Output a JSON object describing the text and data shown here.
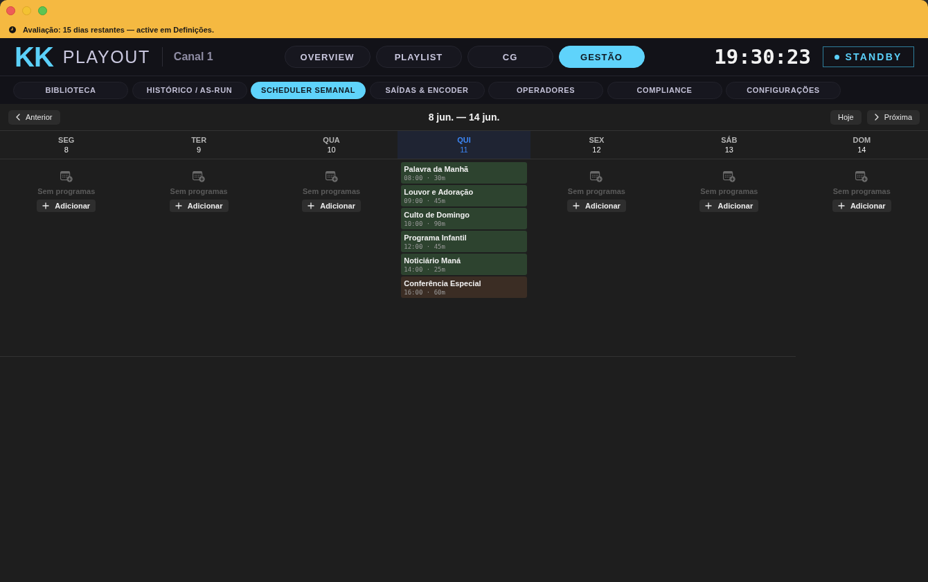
{
  "trial_banner": {
    "text": "Avaliação: 15 dias restantes — active em Definições."
  },
  "header": {
    "logo_mark": "KK",
    "logo_text": "PLAYOUT",
    "channel": "Canal 1",
    "nav_tabs": [
      {
        "label": "OVERVIEW",
        "selected": false
      },
      {
        "label": "PLAYLIST",
        "selected": false
      },
      {
        "label": "CG",
        "selected": false
      },
      {
        "label": "GESTÃO",
        "selected": true
      }
    ],
    "clock": "19:30:23",
    "status": {
      "label": "STANDBY"
    }
  },
  "sub_tabs": [
    {
      "label": "BIBLIOTECA",
      "selected": false
    },
    {
      "label": "HISTÓRICO / AS-RUN",
      "selected": false
    },
    {
      "label": "SCHEDULER SEMANAL",
      "selected": true
    },
    {
      "label": "SAÍDAS & ENCODER",
      "selected": false
    },
    {
      "label": "OPERADORES",
      "selected": false
    },
    {
      "label": "COMPLIANCE",
      "selected": false
    },
    {
      "label": "CONFIGURAÇÕES",
      "selected": false
    }
  ],
  "toolbar": {
    "prev_button": "Anterior",
    "range": "8 jun. — 14 jun.",
    "today_button": "Hoje",
    "next_button": "Próxima"
  },
  "week": {
    "days": [
      {
        "name": "SEG",
        "date": "8",
        "today": false,
        "empty_text": "Sem programas",
        "add_label": "Adicionar"
      },
      {
        "name": "TER",
        "date": "9",
        "today": false,
        "empty_text": "Sem programas",
        "add_label": "Adicionar"
      },
      {
        "name": "QUA",
        "date": "10",
        "today": false,
        "empty_text": "Sem programas",
        "add_label": "Adicionar"
      },
      {
        "name": "QUI",
        "date": "11",
        "today": true,
        "programs": [
          {
            "title": "Palavra da Manhã",
            "time": "08:00 · 30m",
            "color": "#2d432f"
          },
          {
            "title": "Louvor e Adoração",
            "time": "09:00 · 45m",
            "color": "#2d432f"
          },
          {
            "title": "Culto de Domingo",
            "time": "10:00 · 90m",
            "color": "#2d432f"
          },
          {
            "title": "Programa Infantil",
            "time": "12:00 · 45m",
            "color": "#2d432f"
          },
          {
            "title": "Noticiário Maná",
            "time": "14:00 · 25m",
            "color": "#2d432f"
          },
          {
            "title": "Conferência Especial",
            "time": "16:00 · 60m",
            "color": "#3b2d24"
          }
        ]
      },
      {
        "name": "SEX",
        "date": "12",
        "today": false,
        "empty_text": "Sem programas",
        "add_label": "Adicionar"
      },
      {
        "name": "SÁB",
        "date": "13",
        "today": false,
        "empty_text": "Sem programas",
        "add_label": "Adicionar"
      },
      {
        "name": "DOM",
        "date": "14",
        "today": false,
        "empty_text": "Sem programas",
        "add_label": "Adicionar"
      }
    ]
  }
}
